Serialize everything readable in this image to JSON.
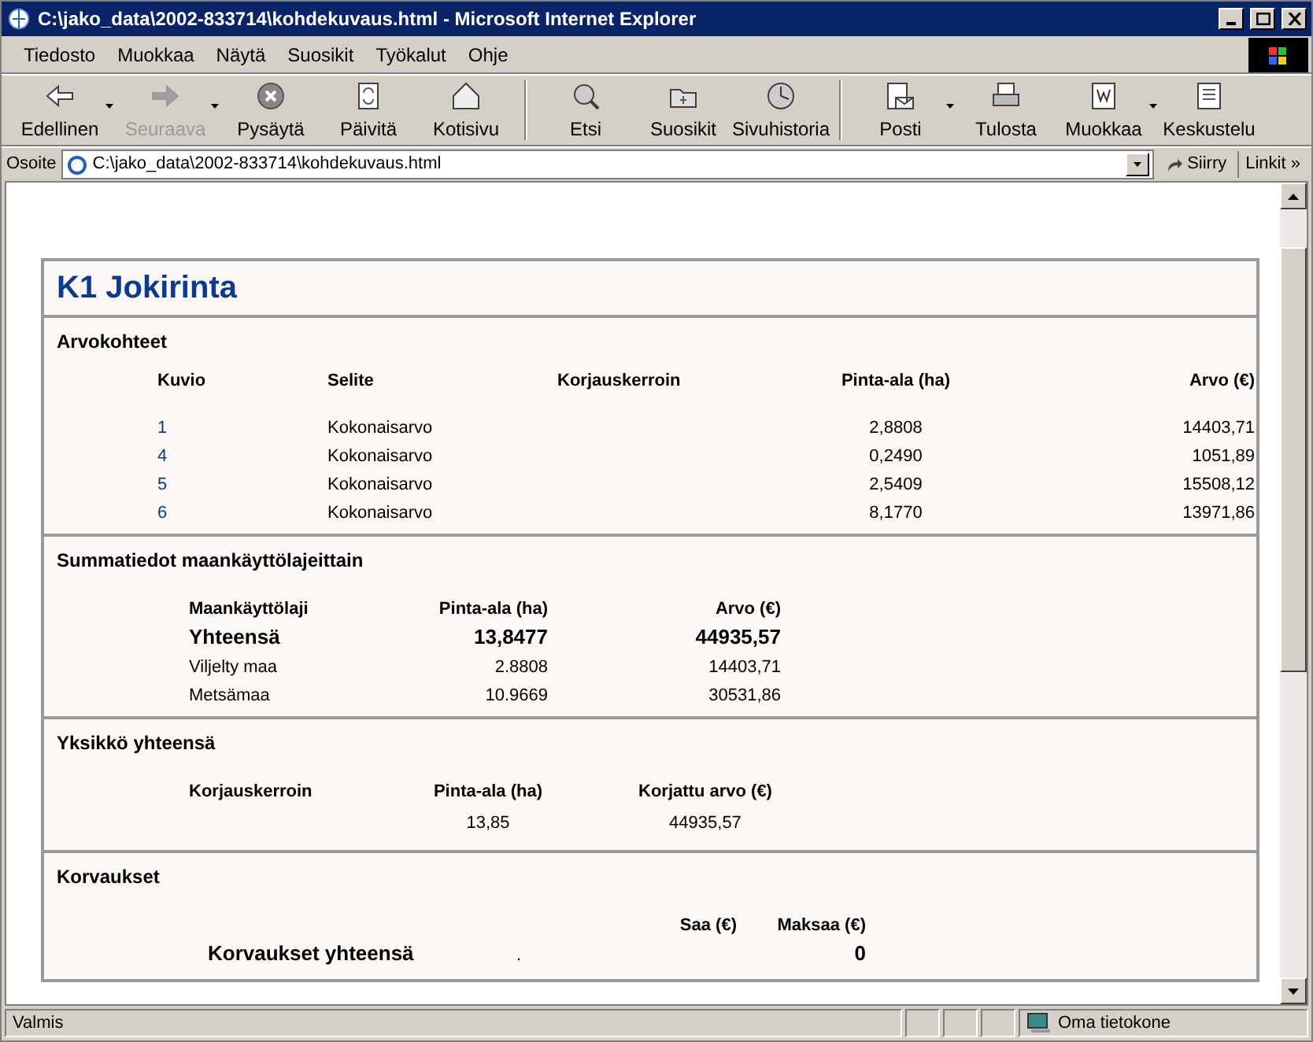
{
  "window": {
    "title": "C:\\jako_data\\2002-833714\\kohdekuvaus.html - Microsoft Internet Explorer"
  },
  "menu": [
    "Tiedosto",
    "Muokkaa",
    "Näytä",
    "Suosikit",
    "Työkalut",
    "Ohje"
  ],
  "toolbar": [
    [
      {
        "label": "Edellinen",
        "disabled": false,
        "dropdown": true
      },
      {
        "label": "Seuraava",
        "disabled": true,
        "dropdown": true
      },
      {
        "label": "Pysäytä",
        "disabled": false,
        "dropdown": false
      },
      {
        "label": "Päivitä",
        "disabled": false,
        "dropdown": false
      },
      {
        "label": "Kotisivu",
        "disabled": false,
        "dropdown": false
      }
    ],
    [
      {
        "label": "Etsi",
        "disabled": false,
        "dropdown": false
      },
      {
        "label": "Suosikit",
        "disabled": false,
        "dropdown": false
      },
      {
        "label": "Sivuhistoria",
        "disabled": false,
        "dropdown": false
      }
    ],
    [
      {
        "label": "Posti",
        "disabled": false,
        "dropdown": true
      },
      {
        "label": "Tulosta",
        "disabled": false,
        "dropdown": false
      },
      {
        "label": "Muokkaa",
        "disabled": false,
        "dropdown": true
      },
      {
        "label": "Keskustelu",
        "disabled": false,
        "dropdown": false
      }
    ]
  ],
  "address_bar": {
    "label": "Osoite",
    "value": "C:\\jako_data\\2002-833714\\kohdekuvaus.html",
    "go": "Siirry",
    "links": "Linkit",
    "more": "»"
  },
  "page": {
    "title": "K1 Jokirinta",
    "arvokohteet": {
      "heading": "Arvokohteet",
      "columns": [
        "Kuvio",
        "Selite",
        "Korjauskerroin",
        "Pinta-ala (ha)",
        "Arvo (€)"
      ],
      "rows": [
        [
          "1",
          "Kokonaisarvo",
          "",
          "2,8808",
          "14403,71"
        ],
        [
          "4",
          "Kokonaisarvo",
          "",
          "0,2490",
          "1051,89"
        ],
        [
          "5",
          "Kokonaisarvo",
          "",
          "2,5409",
          "15508,12"
        ],
        [
          "6",
          "Kokonaisarvo",
          "",
          "8,1770",
          "13971,86"
        ]
      ]
    },
    "summatiedot": {
      "heading": "Summatiedot maankäyttölajeittain",
      "columns": [
        "Maankäyttölaji",
        "Pinta-ala (ha)",
        "Arvo (€)"
      ],
      "rows": [
        {
          "cells": [
            "Yhteensä",
            "13,8477",
            "44935,57"
          ],
          "total": true
        },
        {
          "cells": [
            "Viljelty maa",
            "2.8808",
            "14403,71"
          ],
          "total": false
        },
        {
          "cells": [
            "Metsämaa",
            "10.9669",
            "30531,86"
          ],
          "total": false
        }
      ]
    },
    "yksikko": {
      "heading": "Yksikkö yhteensä",
      "columns": [
        "Korjauskerroin",
        "Pinta-ala (ha)",
        "Korjattu arvo (€)"
      ],
      "values": [
        "13,85",
        "44935,57"
      ]
    },
    "korvaukset": {
      "heading": "Korvaukset",
      "columns": [
        "Saa (€)",
        "Maksaa (€)"
      ],
      "total_label": "Korvaukset yhteensä",
      "values": [
        ".",
        "0"
      ]
    }
  },
  "status_bar": {
    "text": "Valmis",
    "zone": "Oma tietokone"
  }
}
